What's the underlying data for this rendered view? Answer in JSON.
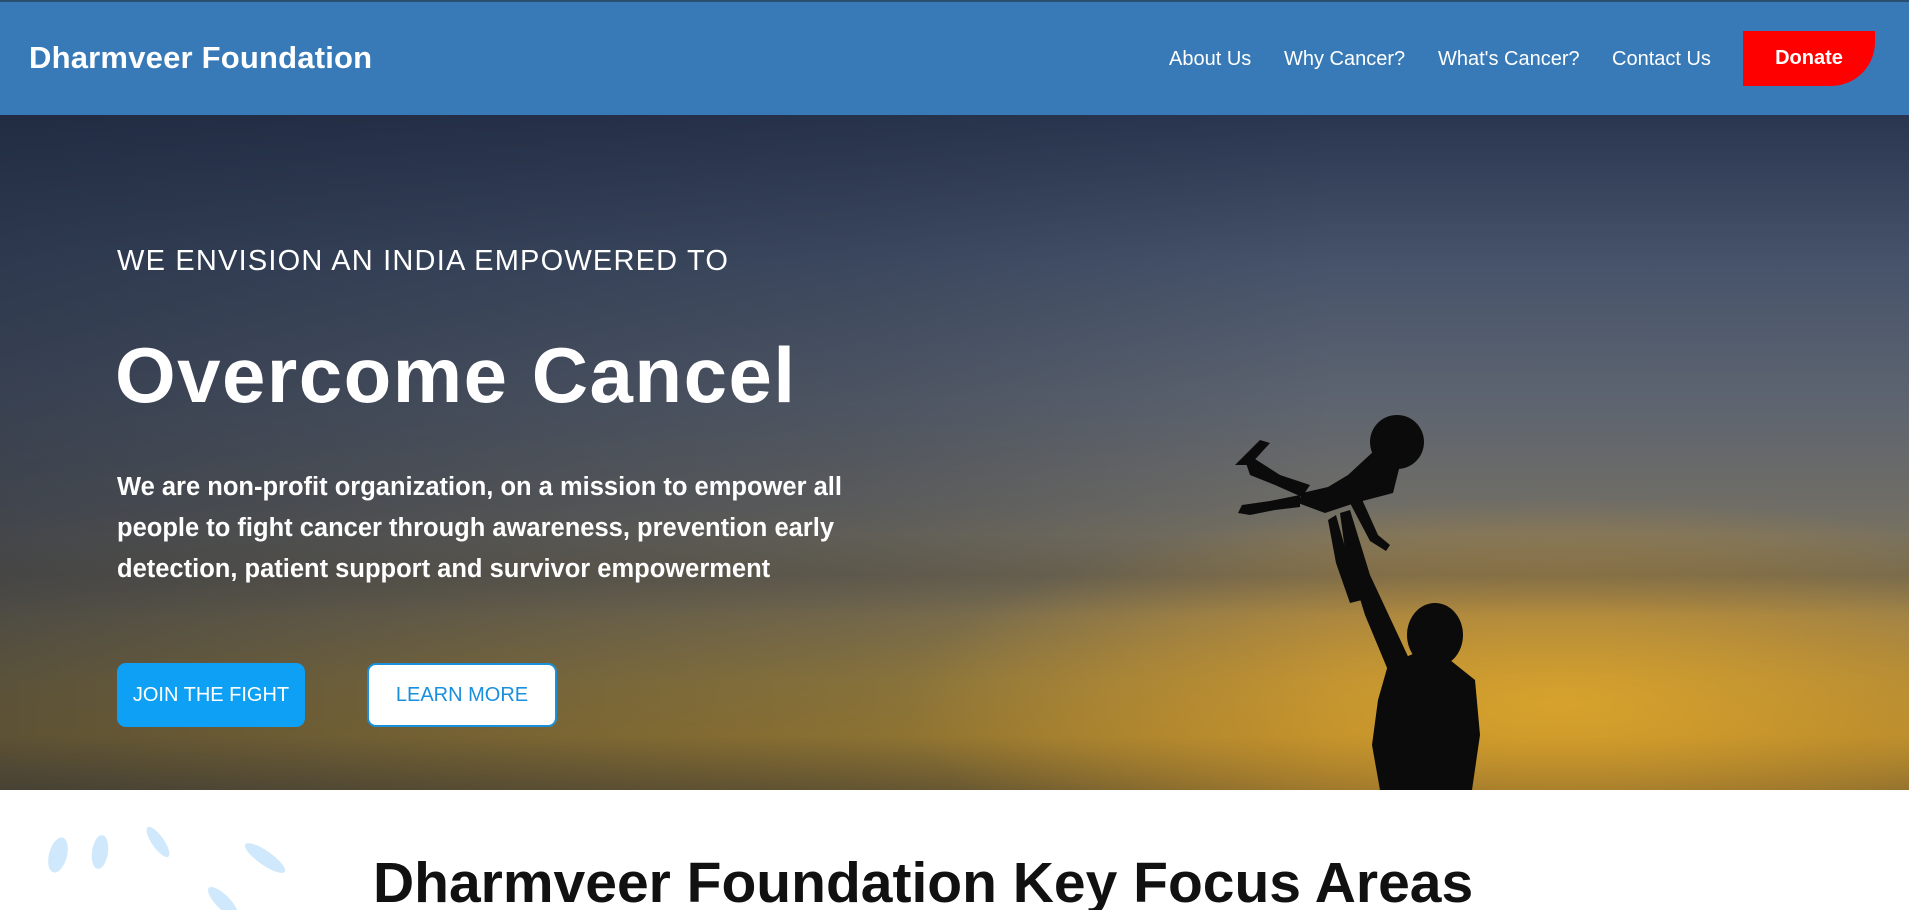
{
  "header": {
    "brand": "Dharmveer Foundation",
    "nav": [
      {
        "label": "About Us"
      },
      {
        "label": "Why Cancer?"
      },
      {
        "label": "What's Cancer?"
      },
      {
        "label": "Contact Us"
      }
    ],
    "donate_label": "Donate",
    "colors": {
      "bar": "#377ab7",
      "donate": "#ff0000"
    }
  },
  "hero": {
    "kicker": "WE ENVISION AN INDIA EMPOWERED TO",
    "title": "Overcome Cancel",
    "description": "We are non-profit organization, on a mission to empower all people to fight cancer through awareness, prevention early detection, patient support and survivor empowerment",
    "primary_button": "JOIN THE FIGHT",
    "secondary_button": "LEARN MORE",
    "colors": {
      "primary": "#0ea0f5",
      "secondary_text": "#1a8fdc"
    }
  },
  "focus_section": {
    "title": "Dharmveer Foundation Key Focus Areas",
    "decor_color": "#cfe8fb"
  }
}
